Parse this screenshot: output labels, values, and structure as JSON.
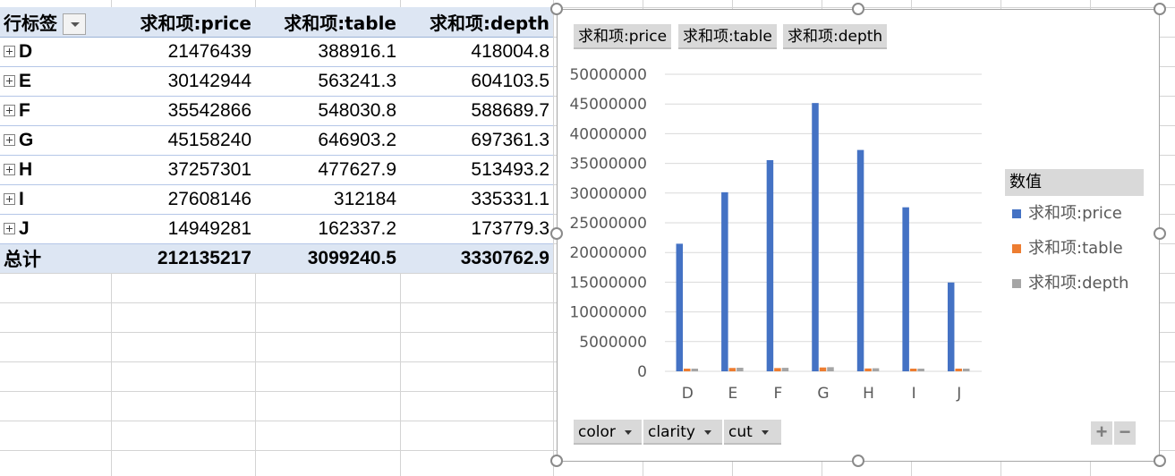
{
  "pivot": {
    "headers": [
      "行标签",
      "求和项:price",
      "求和项:table",
      "求和项:depth"
    ],
    "rows": [
      {
        "label": "D",
        "price": "21476439",
        "table": "388916.1",
        "depth": "418004.8"
      },
      {
        "label": "E",
        "price": "30142944",
        "table": "563241.3",
        "depth": "604103.5"
      },
      {
        "label": "F",
        "price": "35542866",
        "table": "548030.8",
        "depth": "588689.7"
      },
      {
        "label": "G",
        "price": "45158240",
        "table": "646903.2",
        "depth": "697361.3"
      },
      {
        "label": "H",
        "price": "37257301",
        "table": "477627.9",
        "depth": "513493.2"
      },
      {
        "label": "I",
        "price": "27608146",
        "table": "312184",
        "depth": "335331.1"
      },
      {
        "label": "J",
        "price": "14949281",
        "table": "162337.2",
        "depth": "173779.3"
      }
    ],
    "total": {
      "label": "总计",
      "price": "212135217",
      "table": "3099240.5",
      "depth": "3330762.9"
    }
  },
  "chart_panel": {
    "value_buttons": [
      "求和项:price",
      "求和项:table",
      "求和项:depth"
    ],
    "axis_buttons": [
      "color",
      "clarity",
      "cut"
    ],
    "legend_title": "数值",
    "zoom_in": "+",
    "zoom_out": "−"
  },
  "colors": {
    "price": "#4472c4",
    "table": "#ed7d31",
    "depth": "#a5a5a5",
    "header_fill": "#dde6f3"
  },
  "chart_data": {
    "type": "bar",
    "title": "",
    "xlabel": "",
    "ylabel": "",
    "categories": [
      "D",
      "E",
      "F",
      "G",
      "H",
      "I",
      "J"
    ],
    "ylim": [
      0,
      50000000
    ],
    "yticks": [
      "0",
      "5000000",
      "10000000",
      "15000000",
      "20000000",
      "25000000",
      "30000000",
      "35000000",
      "40000000",
      "45000000",
      "50000000"
    ],
    "grid": true,
    "legend_placement": "right",
    "series": [
      {
        "name": "求和项:price",
        "values": [
          21476439,
          30142944,
          35542866,
          45158240,
          37257301,
          27608146,
          14949281
        ]
      },
      {
        "name": "求和项:table",
        "values": [
          388916.1,
          563241.3,
          548030.8,
          646903.2,
          477627.9,
          312184,
          162337.2
        ]
      },
      {
        "name": "求和项:depth",
        "values": [
          418004.8,
          604103.5,
          588689.7,
          697361.3,
          513493.2,
          335331.1,
          173779.3
        ]
      }
    ]
  }
}
